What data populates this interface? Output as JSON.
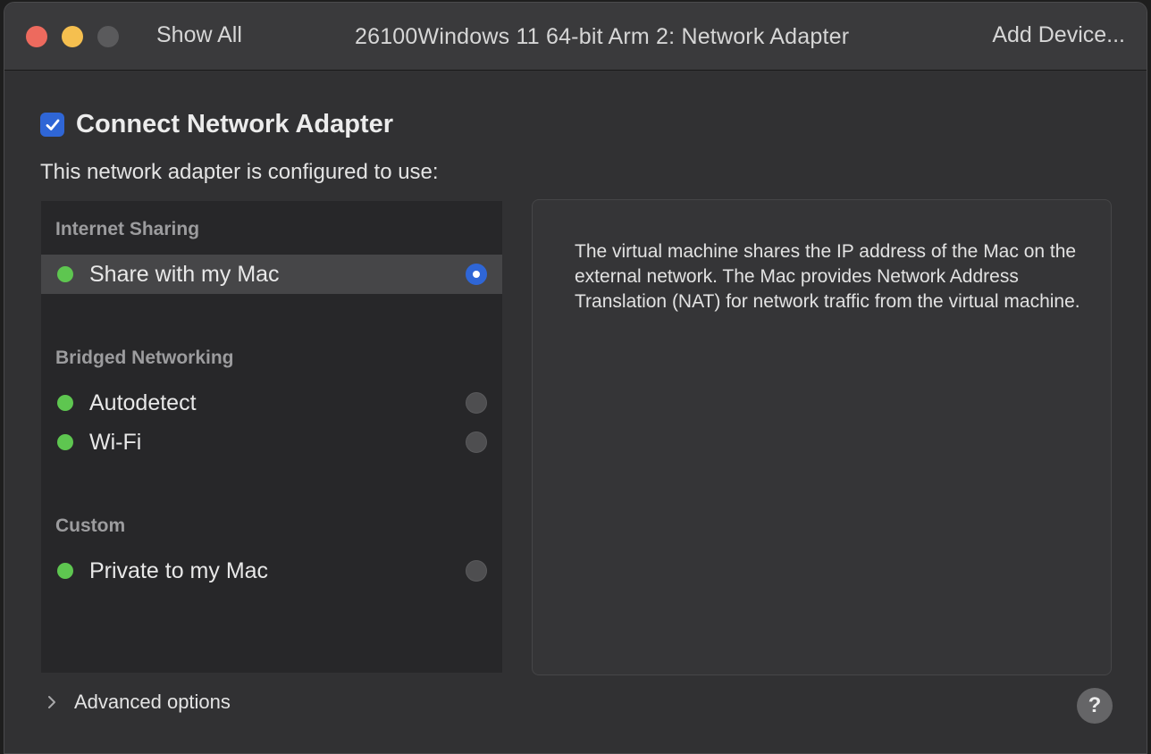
{
  "titlebar": {
    "show_all": "Show All",
    "title": "26100Windows 11 64-bit Arm 2: Network Adapter",
    "add_device": "Add Device..."
  },
  "connect": {
    "checked": true,
    "label": "Connect Network Adapter"
  },
  "configured_text": "This network adapter is configured to use:",
  "sections": {
    "internet_sharing": "Internet Sharing",
    "bridged": "Bridged Networking",
    "custom": "Custom"
  },
  "networks": {
    "share_with_mac": {
      "label": "Share with my Mac",
      "selected": true,
      "status_color": "#5ec650"
    },
    "autodetect": {
      "label": "Autodetect",
      "selected": false,
      "status_color": "#5ec650"
    },
    "wifi": {
      "label": "Wi-Fi",
      "selected": false,
      "status_color": "#5ec650"
    },
    "private_to_mac": {
      "label": "Private to my Mac",
      "selected": false,
      "status_color": "#5ec650"
    }
  },
  "description": "The virtual machine shares the IP address of the Mac on the external network. The Mac provides Network Address Translation (NAT) for network traffic from the virtual machine.",
  "advanced_options": "Advanced options",
  "help": "?",
  "colors": {
    "accent": "#2f66d6",
    "status_green": "#5ec650",
    "close": "#ed6a5e",
    "minimize": "#f5bf4f"
  },
  "icons": {
    "checkbox": "checkmark-icon",
    "advanced": "chevron-right-icon",
    "help": "question-mark-icon"
  }
}
